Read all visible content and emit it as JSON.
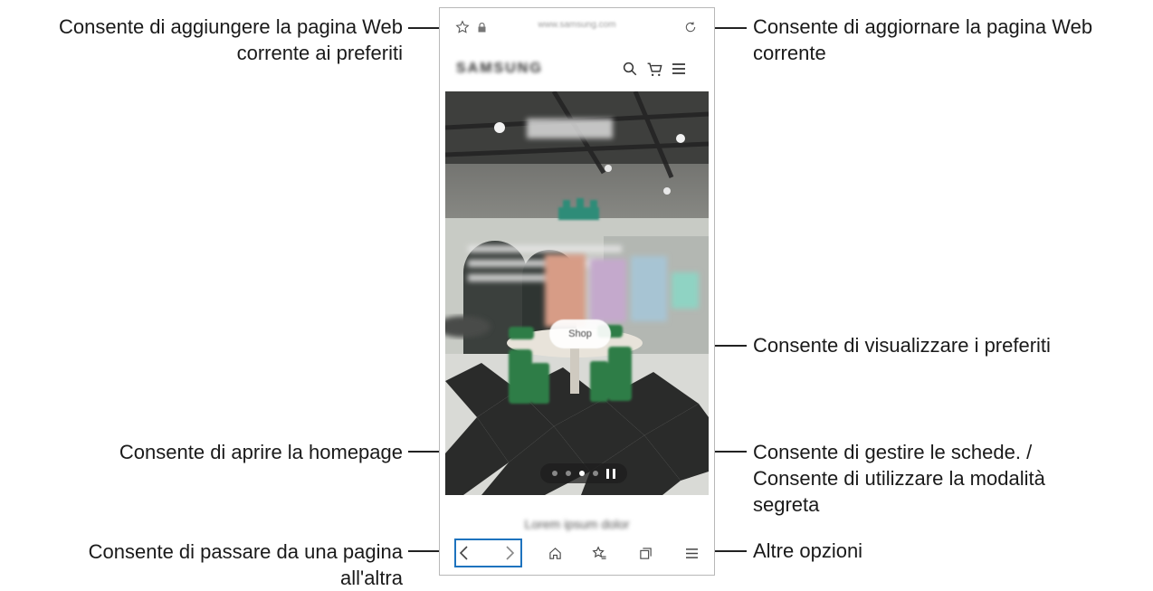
{
  "browser": {
    "url": "www.samsung.com",
    "site_logo": "SAMSUNG",
    "hero_button": "Shop",
    "lower_text": "Lorem ipsum dolor",
    "carousel_dots": 4,
    "carousel_active_index": 2
  },
  "callouts": {
    "add_bookmark": "Consente di aggiungere la pagina Web corrente ai preferiti",
    "add_bookmark_line1": "Consente di aggiungere la pagina Web",
    "add_bookmark_line2": "corrente ai preferiti",
    "refresh_line1": "Consente di aggiornare la pagina Web",
    "refresh_line2": "corrente",
    "bookmarks": "Consente di visualizzare i preferiti",
    "home": "Consente di aprire la homepage",
    "tabs_line1": "Consente di gestire le schede. /",
    "tabs_line2": "Consente di utilizzare la modalità",
    "tabs_line3": "segreta",
    "navigate_line1": "Consente di passare da una pagina",
    "navigate_line2": "all'altra",
    "more": "Altre opzioni"
  },
  "icons": {
    "star": "star-icon",
    "lock": "lock-icon",
    "refresh": "refresh-icon",
    "search": "search-icon",
    "cart": "cart-icon",
    "menu": "menu-icon",
    "back": "chevron-left-icon",
    "forward": "chevron-right-icon",
    "home": "home-icon",
    "bookmarks": "bookmarks-icon",
    "tabs": "tabs-icon",
    "more": "more-icon"
  },
  "colors": {
    "highlight": "#1e73be",
    "line": "#222222"
  }
}
